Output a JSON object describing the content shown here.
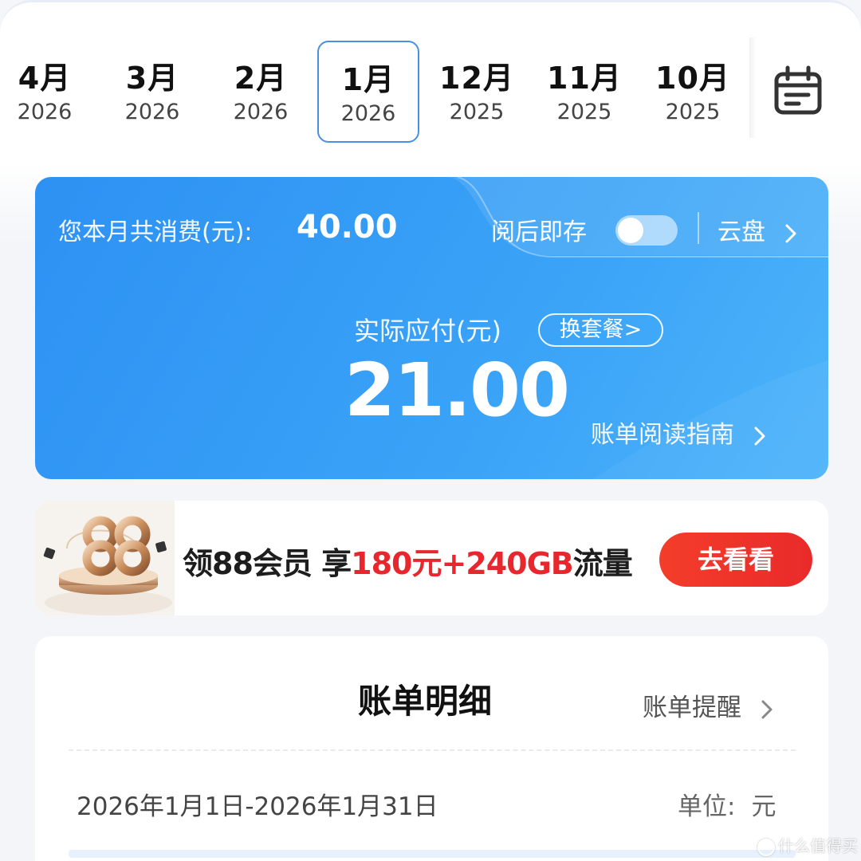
{
  "months": [
    {
      "month": "4月",
      "year": "2026",
      "active": false
    },
    {
      "month": "3月",
      "year": "2026",
      "active": false
    },
    {
      "month": "2月",
      "year": "2026",
      "active": false
    },
    {
      "month": "1月",
      "year": "2026",
      "active": true
    },
    {
      "month": "12月",
      "year": "2025",
      "active": false
    },
    {
      "month": "11月",
      "year": "2025",
      "active": false
    },
    {
      "month": "10月",
      "year": "2025",
      "active": false
    }
  ],
  "calendar_icon": "calendar-icon",
  "bill": {
    "total_label": "您本月共消费(元):",
    "total_value": "40.00",
    "save_label": "阅后即存",
    "save_toggle_on": false,
    "cloud_label": "云盘",
    "actual_label": "实际应付(元)",
    "change_plan_label": "换套餐>",
    "actual_value": "21.00",
    "guide_label": "账单阅读指南"
  },
  "promo": {
    "text_prefix": "领88会员 享",
    "text_highlight": "180元+240GB",
    "text_suffix": "流量",
    "button_label": "去看看",
    "badge_icon": "88-badge-icon"
  },
  "detail": {
    "title": "账单明细",
    "reminder_label": "账单提醒",
    "period": "2026年1月1日-2026年1月31日",
    "unit_label": "单位:",
    "unit_value": "元"
  },
  "watermark": {
    "text": "什么值得买"
  },
  "colors": {
    "accent_blue": "#2d91f3",
    "promo_red": "#e8262d",
    "active_border": "#4a90e2"
  }
}
